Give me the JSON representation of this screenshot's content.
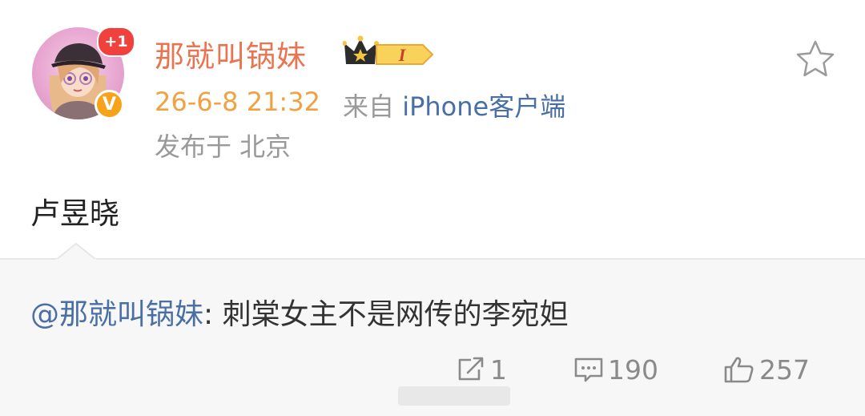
{
  "post": {
    "username": "那就叫锅妹",
    "notification_badge": "+1",
    "verified_mark": "V",
    "level_badge": "I",
    "timestamp": "26-6-8 21:32",
    "source_prefix": "来自 ",
    "source_client": "iPhone客户端",
    "location": "发布于 北京",
    "text": "卢昱晓"
  },
  "repost": {
    "user": "@那就叫锅妹",
    "separator": ": ",
    "text": "刺棠女主不是网传的李宛妲"
  },
  "actions": {
    "reposts": "1",
    "comments": "190",
    "likes": "257"
  },
  "colors": {
    "username": "#eb7350",
    "timestamp": "#f0a142",
    "link": "#4a6fa5",
    "muted": "#999999",
    "repost_bg": "#f7f7f7"
  }
}
